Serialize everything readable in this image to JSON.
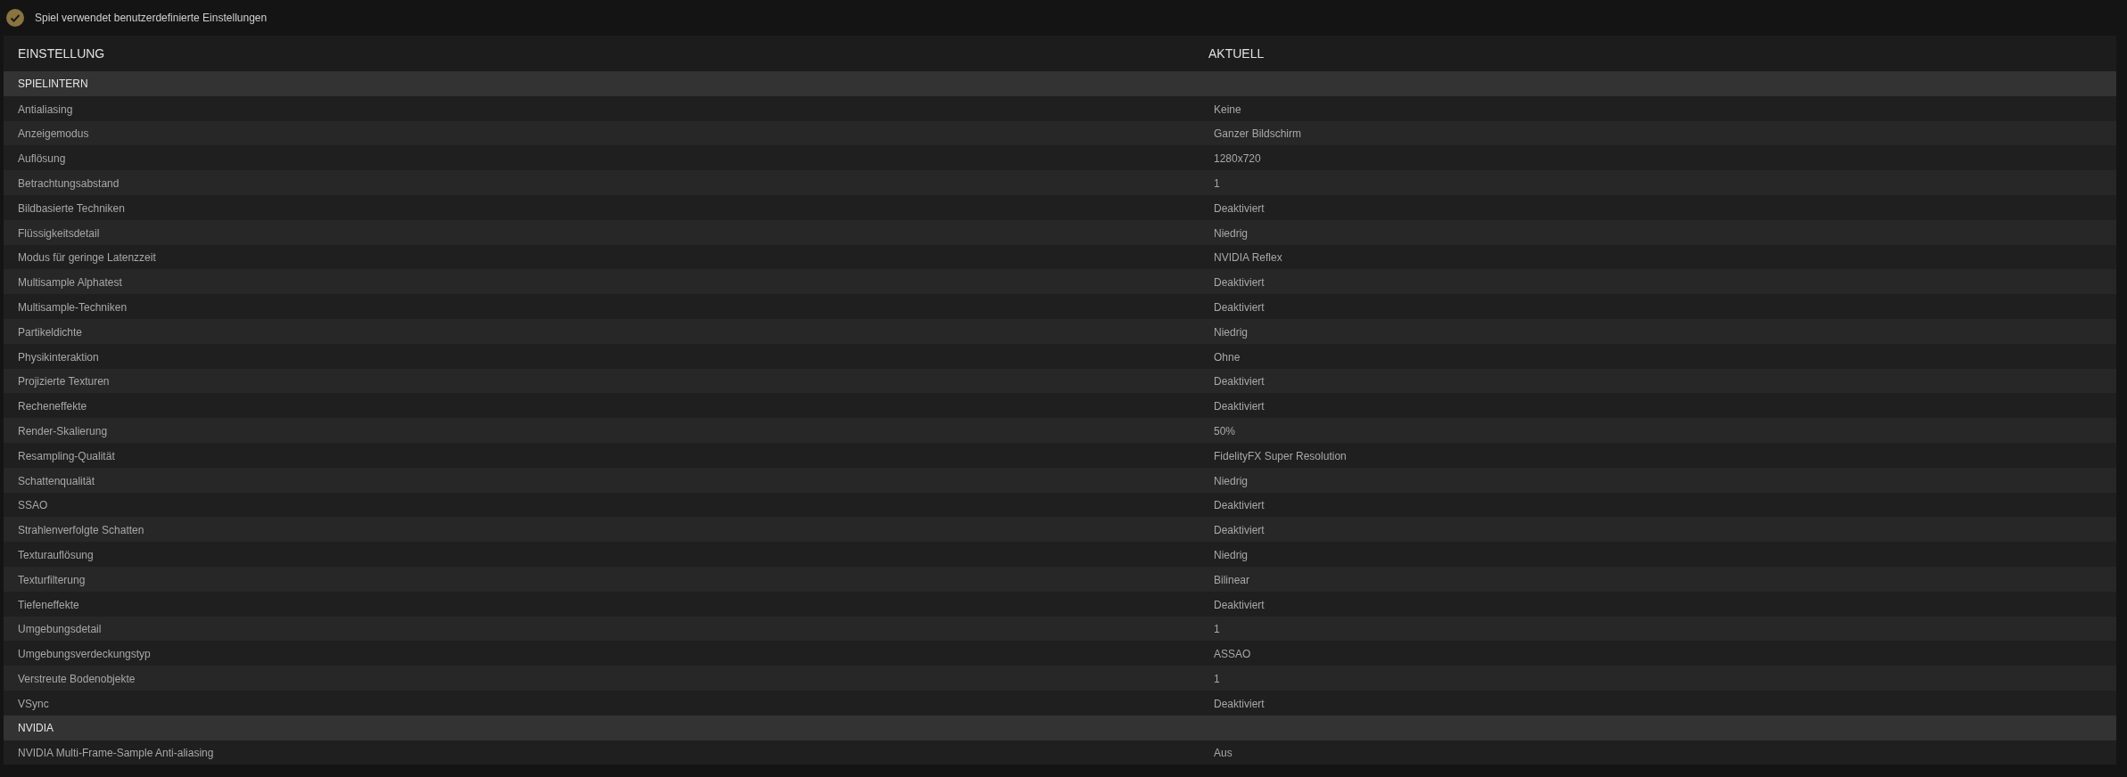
{
  "status": {
    "message": "Spiel verwendet benutzerdefinierte Einstellungen"
  },
  "table": {
    "columns": [
      "EINSTELLUNG",
      "AKTUELL"
    ],
    "groups": [
      {
        "name": "SPIELINTERN",
        "rows": [
          {
            "setting": "Antialiasing",
            "current": "Keine"
          },
          {
            "setting": "Anzeigemodus",
            "current": "Ganzer Bildschirm"
          },
          {
            "setting": "Auflösung",
            "current": "1280x720"
          },
          {
            "setting": "Betrachtungsabstand",
            "current": "1"
          },
          {
            "setting": "Bildbasierte Techniken",
            "current": "Deaktiviert"
          },
          {
            "setting": "Flüssigkeitsdetail",
            "current": "Niedrig"
          },
          {
            "setting": "Modus für geringe Latenzzeit",
            "current": "NVIDIA Reflex"
          },
          {
            "setting": "Multisample Alphatest",
            "current": "Deaktiviert"
          },
          {
            "setting": "Multisample-Techniken",
            "current": "Deaktiviert"
          },
          {
            "setting": "Partikeldichte",
            "current": "Niedrig"
          },
          {
            "setting": "Physikinteraktion",
            "current": "Ohne"
          },
          {
            "setting": "Projizierte Texturen",
            "current": "Deaktiviert"
          },
          {
            "setting": "Recheneffekte",
            "current": "Deaktiviert"
          },
          {
            "setting": "Render-Skalierung",
            "current": "50%"
          },
          {
            "setting": "Resampling-Qualität",
            "current": "FidelityFX Super Resolution"
          },
          {
            "setting": "Schattenqualität",
            "current": "Niedrig"
          },
          {
            "setting": "SSAO",
            "current": "Deaktiviert"
          },
          {
            "setting": "Strahlenverfolgte Schatten",
            "current": "Deaktiviert"
          },
          {
            "setting": "Texturauflösung",
            "current": "Niedrig"
          },
          {
            "setting": "Texturfilterung",
            "current": "Bilinear"
          },
          {
            "setting": "Tiefeneffekte",
            "current": "Deaktiviert"
          },
          {
            "setting": "Umgebungsdetail",
            "current": "1"
          },
          {
            "setting": "Umgebungsverdeckungstyp",
            "current": "ASSAO"
          },
          {
            "setting": "Verstreute Bodenobjekte",
            "current": "1"
          },
          {
            "setting": "VSync",
            "current": "Deaktiviert"
          }
        ]
      },
      {
        "name": "NVIDIA",
        "rows": [
          {
            "setting": "NVIDIA Multi-Frame-Sample Anti-aliasing",
            "current": "Aus"
          }
        ]
      }
    ]
  }
}
